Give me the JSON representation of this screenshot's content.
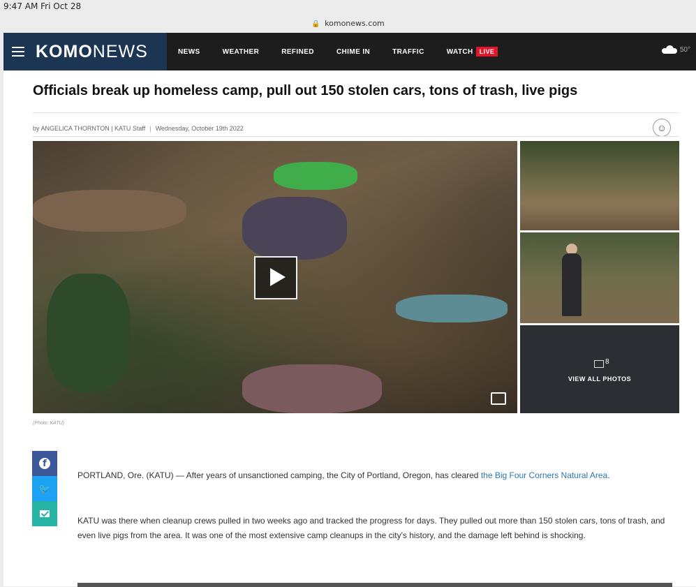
{
  "status_bar": {
    "time": "9:47 AM  Fri Oct 28"
  },
  "browser": {
    "url": "komonews.com"
  },
  "nav": {
    "logo_bold": "KOMO",
    "logo_light": "NEWS",
    "links": [
      "NEWS",
      "WEATHER",
      "REFINED",
      "CHIME IN",
      "TRAFFIC",
      "WATCH"
    ],
    "live_badge": "LIVE",
    "temperature": "50°",
    "live_color": "#e3152a",
    "brand_color": "#1b3552"
  },
  "article": {
    "headline": "Officials break up homeless camp, pull out 150 stolen cars, tons of trash, live pigs",
    "byline": "by ANGELICA THORNTON | KATU Staff",
    "date": "Wednesday, October 19th 2022",
    "photo_caption": "(Photo: KATU)",
    "photo_count": "8",
    "view_all_label": "VIEW ALL PHOTOS",
    "paragraph1_text": "PORTLAND, Ore. (KATU) — After years of unsanctioned camping, the City of Portland, Oregon, has cleared ",
    "paragraph1_link": "the Big Four Corners Natural Area",
    "paragraph1_end": ".",
    "paragraph2": "KATU was there when cleanup crews pulled in two weeks ago and tracked the progress for days. They pulled out more than 150 stolen cars, tons of trash, and even live pigs from the area. It was one of the most extensive camp cleanups in the city's history, and the damage left behind is shocking."
  },
  "icons": {
    "share": [
      "facebook-icon",
      "twitter-icon",
      "email-icon"
    ],
    "accessibility": "accessibility-icon",
    "weather": "cloud-icon",
    "lock": "lock-icon"
  }
}
